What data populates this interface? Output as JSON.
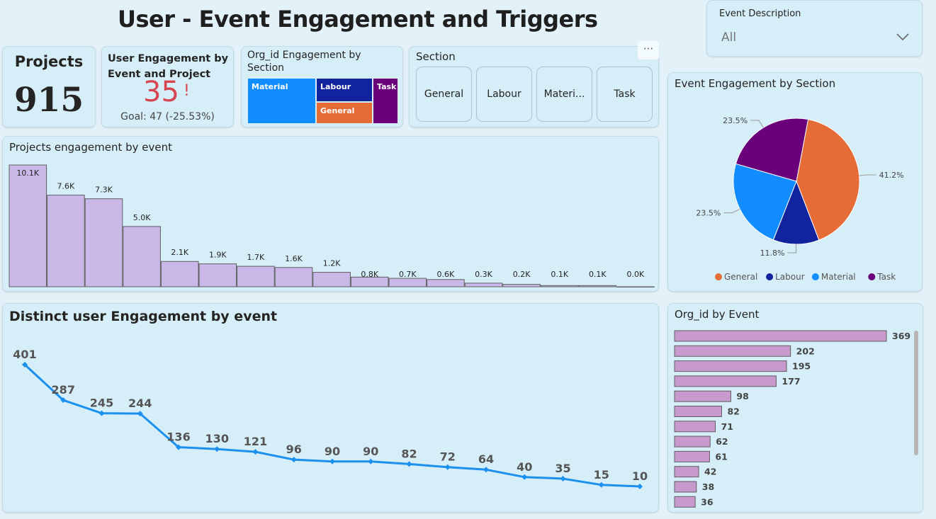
{
  "page_title": "User - Event Engagement and Triggers",
  "projects_card": {
    "label": "Projects",
    "value": "915"
  },
  "kpi": {
    "title": "User Engagement by Event and Project",
    "value": "35",
    "alert": "!",
    "goal": "Goal: 47 (-25.53%)"
  },
  "treemap": {
    "title": "Org_id Engagement by Section",
    "tiles": [
      {
        "label": "Material",
        "color": "#118dff"
      },
      {
        "label": "Labour",
        "color": "#12239e"
      },
      {
        "label": "Task",
        "color": "#6b007b"
      },
      {
        "label": "General",
        "color": "#e66c37"
      }
    ]
  },
  "section_slicer": {
    "title": "Section",
    "more": "···",
    "options": [
      "General",
      "Labour",
      "Materi...",
      "Task"
    ]
  },
  "event_filter": {
    "label": "Event Description",
    "value": "All"
  },
  "colors": {
    "bar": "#c9b8e8",
    "line": "#1b90ee",
    "hbar": "#c799cc",
    "kpi_red": "#d64550"
  },
  "charts": {
    "projects_by_event": {
      "title": "Projects engagement by event",
      "chart_data": {
        "type": "bar",
        "values": [
          10.1,
          7.6,
          7.3,
          5.0,
          2.1,
          1.9,
          1.7,
          1.6,
          1.2,
          0.8,
          0.7,
          0.6,
          0.3,
          0.2,
          0.1,
          0.1,
          0.0
        ],
        "labels": [
          "10.1K",
          "7.6K",
          "7.3K",
          "5.0K",
          "2.1K",
          "1.9K",
          "1.7K",
          "1.6K",
          "1.2K",
          "0.8K",
          "0.7K",
          "0.6K",
          "0.3K",
          "0.2K",
          "0.1K",
          "0.1K",
          "0.0K"
        ],
        "unit": "K"
      }
    },
    "distinct_users": {
      "title": "Distinct user Engagement by event",
      "chart_data": {
        "type": "line",
        "values": [
          401,
          287,
          245,
          244,
          136,
          130,
          121,
          96,
          90,
          90,
          82,
          72,
          64,
          40,
          35,
          15,
          10
        ]
      }
    },
    "section_pie": {
      "title": "Event Engagement by Section",
      "chart_data": {
        "type": "pie",
        "slices": [
          {
            "name": "General",
            "value": 41.2,
            "label": "41.2%",
            "color": "#e66c37"
          },
          {
            "name": "Labour",
            "value": 11.8,
            "label": "11.8%",
            "color": "#12239e"
          },
          {
            "name": "Material",
            "value": 23.5,
            "label": "23.5%",
            "color": "#118dff"
          },
          {
            "name": "Task",
            "value": 23.5,
            "label": "23.5%",
            "color": "#6b007b"
          }
        ],
        "legend": [
          "General",
          "Labour",
          "Material",
          "Task"
        ]
      }
    },
    "org_by_event": {
      "title": "Org_id by Event",
      "chart_data": {
        "type": "bar",
        "orientation": "horizontal",
        "values": [
          369,
          202,
          195,
          177,
          98,
          82,
          71,
          62,
          61,
          42,
          38,
          36
        ]
      }
    }
  }
}
